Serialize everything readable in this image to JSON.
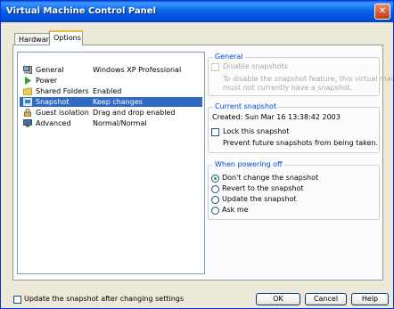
{
  "window": {
    "title": "Virtual Machine Control Panel",
    "close_glyph": "✕"
  },
  "tabs": [
    {
      "label": "Hardware"
    },
    {
      "label": "Options"
    }
  ],
  "options_list": [
    {
      "name": "General",
      "value": "Windows XP Professional",
      "icon": "computer-icon"
    },
    {
      "name": "Power",
      "value": "",
      "icon": "play-icon"
    },
    {
      "name": "Shared Folders",
      "value": "Enabled",
      "icon": "folder-icon"
    },
    {
      "name": "Snapshot",
      "value": "Keep changes",
      "icon": "snapshot-icon"
    },
    {
      "name": "Guest isolation",
      "value": "Drag and drop enabled",
      "icon": "lock-icon"
    },
    {
      "name": "Advanced",
      "value": "Normal/Normal",
      "icon": "monitor-icon"
    }
  ],
  "selected_option": "Snapshot",
  "general_group": {
    "legend": "General",
    "disable_snapshots_label": "Disable snapshots",
    "disable_note_line1": "To disable the snapshot feature, this virtual machine",
    "disable_note_line2": "must not currently have a snapshot."
  },
  "current_snapshot_group": {
    "legend": "Current snapshot",
    "created": "Created:  Sun Mar 16 13:38:42 2003",
    "lock_label": "Lock this snapshot",
    "lock_note": "Prevent future snapshots from being taken."
  },
  "powering_off_group": {
    "legend": "When powering off",
    "options": [
      "Don't change the snapshot",
      "Revert to the snapshot",
      "Update the snapshot",
      "Ask me"
    ],
    "selected": "Don't change the snapshot"
  },
  "footer": {
    "update_checkbox_label": "Update the snapshot after changing settings",
    "ok_label": "OK",
    "cancel_label": "Cancel",
    "help_label": "Help"
  },
  "colors": {
    "title_bar": "#0055e5",
    "selection": "#316ac5",
    "legend_text": "#0046d5",
    "tab_highlight": "#f3b64a"
  }
}
